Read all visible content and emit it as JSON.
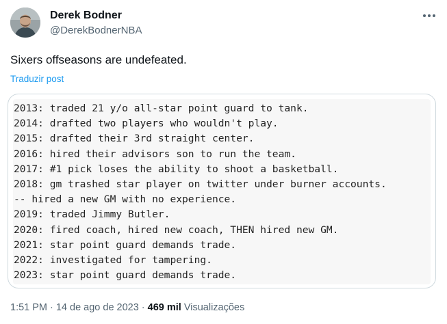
{
  "author": {
    "name": "Derek Bodner",
    "handle": "@DerekBodnerNBA"
  },
  "icons": {
    "avatar": "profile-photo",
    "more": "more-options-icon"
  },
  "post": {
    "text": "Sixers offseasons are undefeated.",
    "translate_label": "Traduzir post",
    "image_lines": [
      "2013: traded 21 y/o all-star point guard to tank.",
      "2014: drafted two players who wouldn't play.",
      "2015: drafted their 3rd straight center.",
      "2016: hired their advisors son to run the team.",
      "2017: #1 pick loses the ability to shoot a basketball.",
      "2018: gm trashed star player on twitter under burner accounts.",
      "-- hired a new GM with no experience.",
      "2019: traded Jimmy Butler.",
      "2020: fired coach, hired new coach, THEN hired new GM.",
      "2021: star point guard demands trade.",
      "2022: investigated for tampering.",
      "2023: star point guard demands trade."
    ]
  },
  "meta": {
    "time": "1:51 PM",
    "separator": "·",
    "date": "14 de ago de 2023",
    "views_count": "469 mil",
    "views_label": "Visualizações"
  },
  "colors": {
    "accent": "#1d9bf0",
    "secondary_text": "#536471",
    "primary_text": "#0f1419",
    "border": "#cfd9de"
  }
}
